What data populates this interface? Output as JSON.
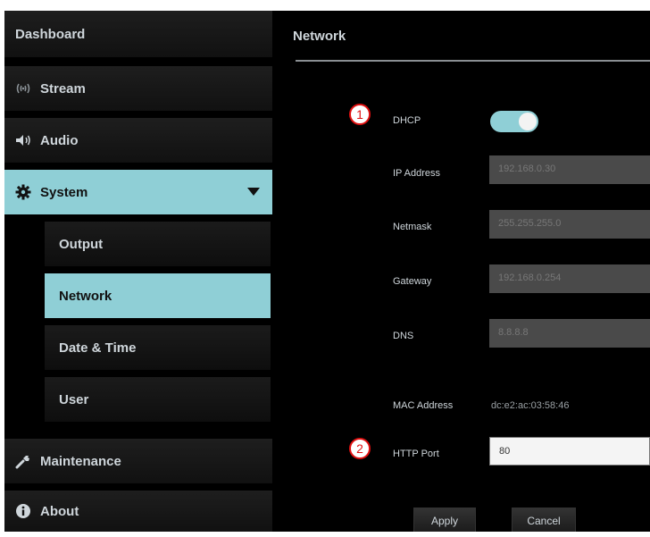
{
  "sidebar": {
    "items": [
      {
        "label": "Dashboard",
        "icon": "none"
      },
      {
        "label": "Stream",
        "icon": "stream-icon"
      },
      {
        "label": "Audio",
        "icon": "speaker-icon"
      },
      {
        "label": "System",
        "icon": "gear-icon",
        "expanded": true
      },
      {
        "label": "Maintenance",
        "icon": "wrench-icon"
      },
      {
        "label": "About",
        "icon": "info-icon"
      }
    ],
    "system_subitems": [
      {
        "label": "Output"
      },
      {
        "label": "Network",
        "active": true
      },
      {
        "label": "Date & Time"
      },
      {
        "label": "User"
      }
    ]
  },
  "main": {
    "title": "Network",
    "dhcp": {
      "label": "DHCP",
      "enabled": true
    },
    "ip_address": {
      "label": "IP Address",
      "value": "192.168.0.30"
    },
    "netmask": {
      "label": "Netmask",
      "value": "255.255.255.0"
    },
    "gateway": {
      "label": "Gateway",
      "value": "192.168.0.254"
    },
    "dns": {
      "label": "DNS",
      "value": "8.8.8.8"
    },
    "mac_address": {
      "label": "MAC Address",
      "value": "dc:e2:ac:03:58:46"
    },
    "http_port": {
      "label": "HTTP Port",
      "value": "80"
    },
    "buttons": {
      "apply": "Apply",
      "cancel": "Cancel"
    }
  },
  "callouts": [
    "1",
    "2"
  ],
  "colors": {
    "accent": "#8fcfd6",
    "callout": "#e01010"
  }
}
